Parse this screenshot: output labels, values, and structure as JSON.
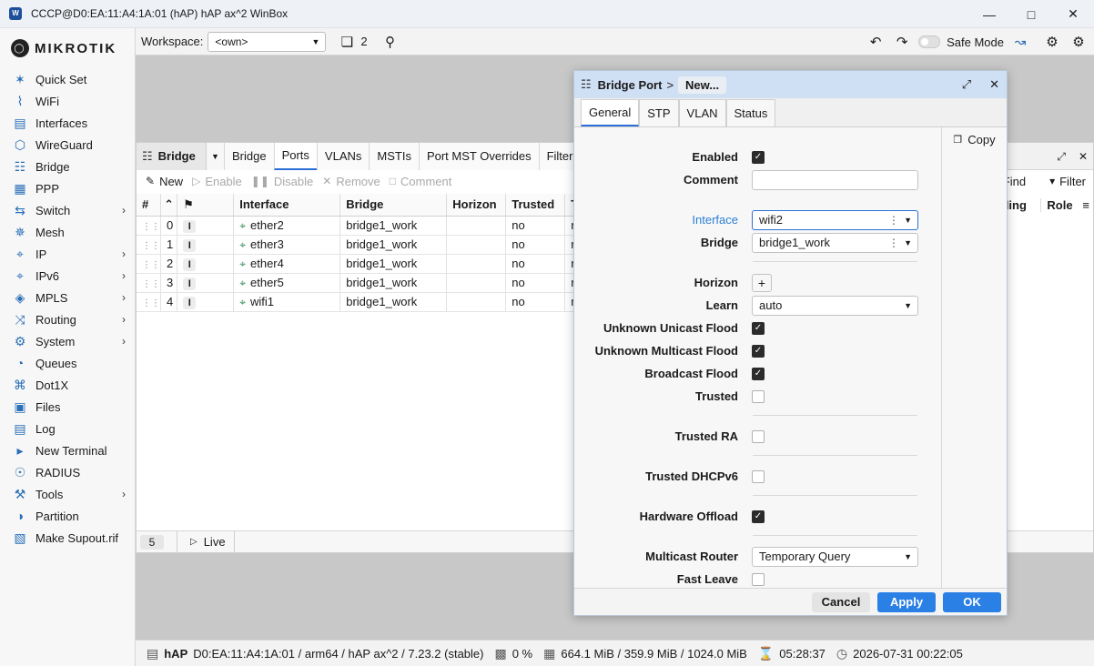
{
  "window": {
    "title": "CCCP@D0:EA:11:A4:1A:01 (hAP) hAP ax^2 WinBox"
  },
  "brand": "MIKROTIK",
  "toolbar": {
    "workspace_label": "Workspace:",
    "workspace_value": "<own>",
    "windows_count": "2",
    "safe_mode": "Safe Mode"
  },
  "sidebar": {
    "items": [
      {
        "label": "Quick Set",
        "icon": "wand-icon",
        "arrow": false
      },
      {
        "label": "WiFi",
        "icon": "wifi-icon",
        "arrow": false
      },
      {
        "label": "Interfaces",
        "icon": "interfaces-icon",
        "arrow": false
      },
      {
        "label": "WireGuard",
        "icon": "wireguard-icon",
        "arrow": false
      },
      {
        "label": "Bridge",
        "icon": "bridge-icon",
        "arrow": false
      },
      {
        "label": "PPP",
        "icon": "ppp-icon",
        "arrow": false
      },
      {
        "label": "Switch",
        "icon": "switch-icon",
        "arrow": true
      },
      {
        "label": "Mesh",
        "icon": "mesh-icon",
        "arrow": false
      },
      {
        "label": "IP",
        "icon": "ip-icon",
        "arrow": true
      },
      {
        "label": "IPv6",
        "icon": "ipv6-icon",
        "arrow": true
      },
      {
        "label": "MPLS",
        "icon": "mpls-icon",
        "arrow": true
      },
      {
        "label": "Routing",
        "icon": "routing-icon",
        "arrow": true
      },
      {
        "label": "System",
        "icon": "gear-icon",
        "arrow": true
      },
      {
        "label": "Queues",
        "icon": "queues-icon",
        "arrow": false
      },
      {
        "label": "Dot1X",
        "icon": "dot1x-icon",
        "arrow": false
      },
      {
        "label": "Files",
        "icon": "files-icon",
        "arrow": false
      },
      {
        "label": "Log",
        "icon": "log-icon",
        "arrow": false
      },
      {
        "label": "New Terminal",
        "icon": "terminal-icon",
        "arrow": false
      },
      {
        "label": "RADIUS",
        "icon": "radius-icon",
        "arrow": false
      },
      {
        "label": "Tools",
        "icon": "tools-icon",
        "arrow": true
      },
      {
        "label": "Partition",
        "icon": "partition-icon",
        "arrow": false
      },
      {
        "label": "Make Supout.rif",
        "icon": "supout-icon",
        "arrow": false
      }
    ]
  },
  "bridge_window": {
    "title": "Bridge",
    "tabs": [
      "Bridge",
      "Ports",
      "VLANs",
      "MSTIs",
      "Port MST Overrides",
      "Filters"
    ],
    "actions": {
      "new": "New",
      "enable": "Enable",
      "disable": "Disable",
      "remove": "Remove",
      "comment": "Comment",
      "find": "Find",
      "filter": "Filter"
    },
    "columns": {
      "num": "#",
      "interface": "Interface",
      "bridge": "Bridge",
      "horizon": "Horizon",
      "trusted": "Trusted",
      "t": "T",
      "forwarding": "rding",
      "role": "Role"
    },
    "rows": [
      {
        "num": "0",
        "flag": "I",
        "interface": "ether2",
        "bridge": "bridge1_work",
        "horizon": "",
        "trusted": "no",
        "t": "r"
      },
      {
        "num": "1",
        "flag": "I",
        "interface": "ether3",
        "bridge": "bridge1_work",
        "horizon": "",
        "trusted": "no",
        "t": "r"
      },
      {
        "num": "2",
        "flag": "I",
        "interface": "ether4",
        "bridge": "bridge1_work",
        "horizon": "",
        "trusted": "no",
        "t": "r"
      },
      {
        "num": "3",
        "flag": "I",
        "interface": "ether5",
        "bridge": "bridge1_work",
        "horizon": "",
        "trusted": "no",
        "t": "r"
      },
      {
        "num": "4",
        "flag": "I",
        "interface": "wifi1",
        "bridge": "bridge1_work",
        "horizon": "",
        "trusted": "no",
        "t": "r"
      }
    ],
    "footer": {
      "count": "5",
      "live": "Live"
    }
  },
  "dialog": {
    "title": "Bridge Port",
    "crumb": "New...",
    "tabs": [
      "General",
      "STP",
      "VLAN",
      "Status"
    ],
    "copy": "Copy",
    "labels": {
      "enabled": "Enabled",
      "comment": "Comment",
      "interface": "Interface",
      "bridge": "Bridge",
      "horizon": "Horizon",
      "learn": "Learn",
      "unknown_unicast": "Unknown Unicast Flood",
      "unknown_multicast": "Unknown Multicast Flood",
      "broadcast": "Broadcast Flood",
      "trusted": "Trusted",
      "trusted_ra": "Trusted RA",
      "trusted_dhcpv6": "Trusted DHCPv6",
      "hw_offload": "Hardware Offload",
      "multicast_router": "Multicast Router",
      "fast_leave": "Fast Leave"
    },
    "values": {
      "interface": "wifi2",
      "bridge": "bridge1_work",
      "learn": "auto",
      "multicast_router": "Temporary Query",
      "comment": ""
    },
    "checks": {
      "enabled": true,
      "unknown_unicast": true,
      "unknown_multicast": true,
      "broadcast": true,
      "trusted": false,
      "trusted_ra": false,
      "trusted_dhcpv6": false,
      "hw_offload": true,
      "fast_leave": false
    },
    "buttons": {
      "cancel": "Cancel",
      "apply": "Apply",
      "ok": "OK"
    }
  },
  "status": {
    "device": "hAP",
    "identity": "D0:EA:11:A4:1A:01 / arm64 / hAP ax^2 / 7.23.2 (stable)",
    "cpu": "0 %",
    "memory": "664.1 MiB / 359.9 MiB / 1024.0 MiB",
    "uptime": "05:28:37",
    "datetime": "2026-07-31 00:22:05"
  }
}
